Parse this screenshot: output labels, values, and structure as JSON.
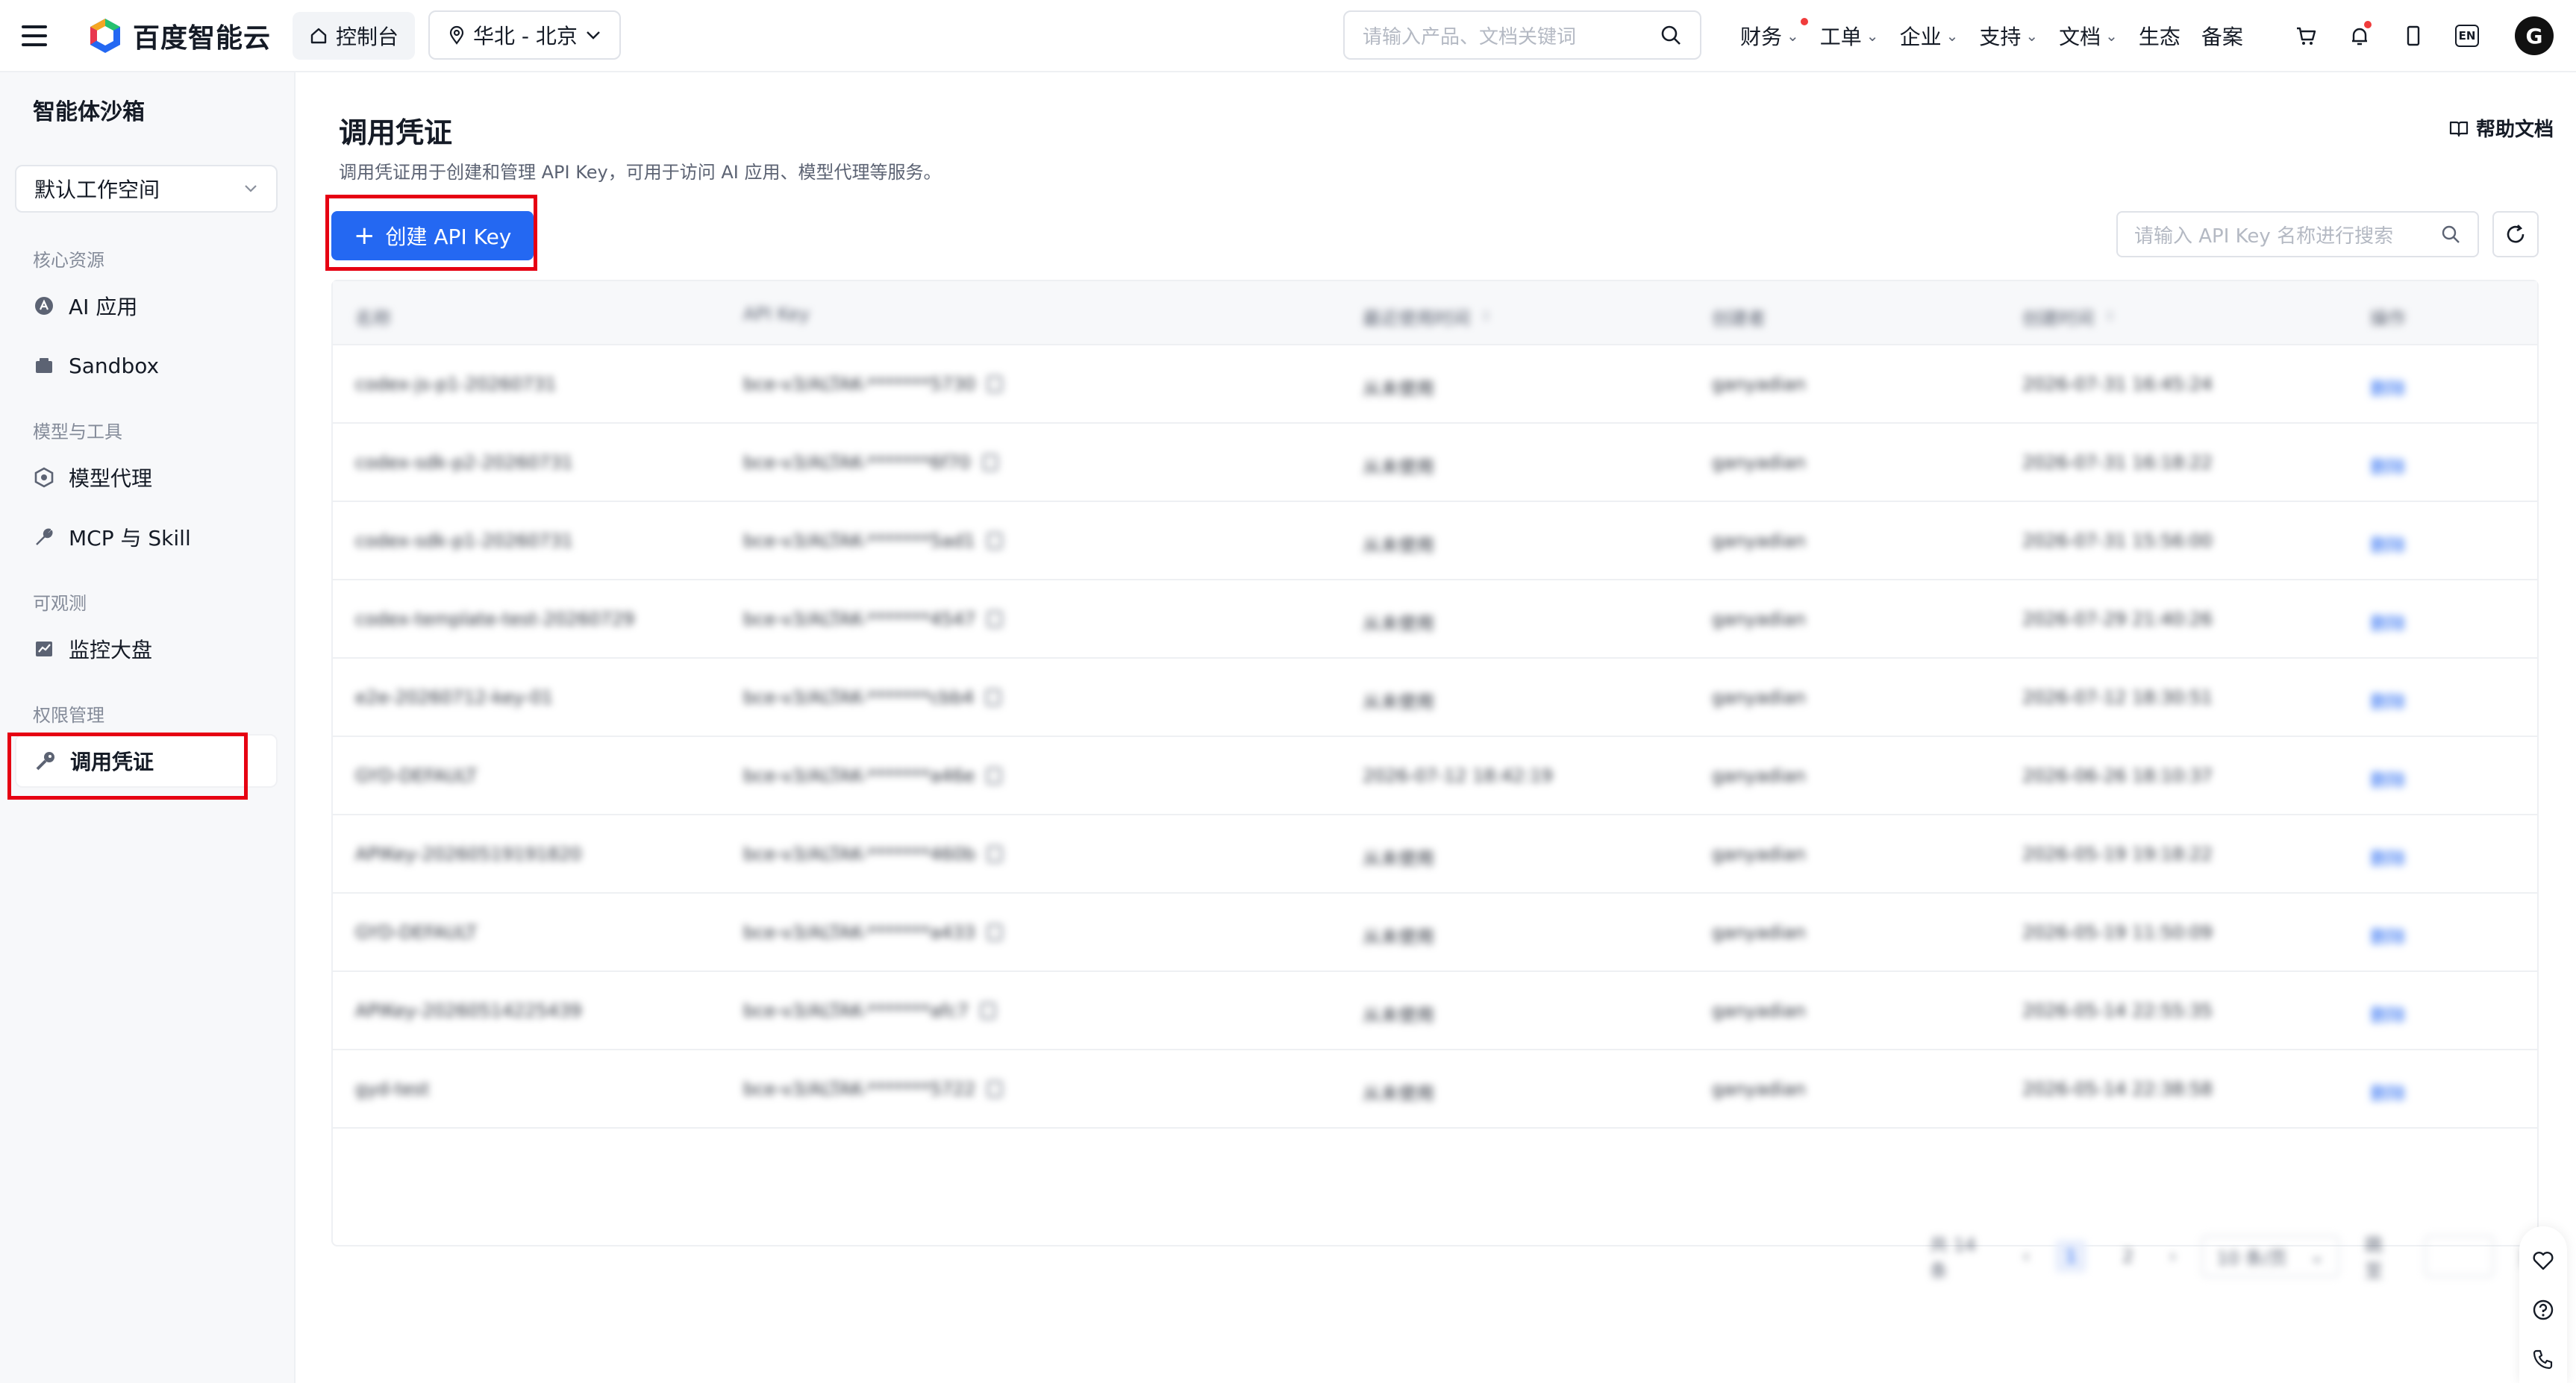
{
  "topbar": {
    "brand": "百度智能云",
    "console": "控制台",
    "region": "华北 - 北京",
    "search_placeholder": "请输入产品、文档关键词",
    "menu": [
      {
        "label": "财务",
        "has_dot": true
      },
      {
        "label": "工单",
        "has_dot": false
      },
      {
        "label": "企业",
        "has_dot": false
      },
      {
        "label": "支持",
        "has_dot": false
      },
      {
        "label": "文档",
        "has_dot": false
      },
      {
        "label": "生态",
        "has_dot": false
      },
      {
        "label": "备案",
        "has_dot": false
      }
    ],
    "lang": "EN",
    "avatar": "G"
  },
  "sidebar": {
    "title": "智能体沙箱",
    "workspace": "默认工作空间",
    "groups": [
      {
        "label": "核心资源",
        "items": [
          "AI 应用",
          "Sandbox"
        ]
      },
      {
        "label": "模型与工具",
        "items": [
          "模型代理",
          "MCP 与 Skill"
        ]
      },
      {
        "label": "可观测",
        "items": [
          "监控大盘"
        ]
      },
      {
        "label": "权限管理",
        "items": [
          "调用凭证"
        ]
      }
    ],
    "active_item": "调用凭证"
  },
  "main": {
    "title": "调用凭证",
    "description": "调用凭证用于创建和管理 API Key，可用于访问 AI 应用、模型代理等服务。",
    "help": "帮助文档",
    "create_button": "创建 API Key",
    "search_placeholder": "请输入 API Key 名称进行搜索"
  },
  "table": {
    "columns": [
      "名称",
      "API Key",
      "最近使用时间",
      "创建者",
      "创建时间",
      "操作"
    ],
    "rows": [
      {
        "name": "codex-js-p1-20260731",
        "key": "bce-v3/ALTAK-*******5730",
        "last_used": "从未使用",
        "creator": "ganyadian",
        "created": "2026-07-31 16:45:24",
        "op": "删除"
      },
      {
        "name": "codex-sdk-p2-20260731",
        "key": "bce-v3/ALTAK-*******6f70",
        "last_used": "从未使用",
        "creator": "ganyadian",
        "created": "2026-07-31 16:18:22",
        "op": "删除"
      },
      {
        "name": "codex-sdk-p1-20260731",
        "key": "bce-v3/ALTAK-*******5ad1",
        "last_used": "从未使用",
        "creator": "ganyadian",
        "created": "2026-07-31 15:56:00",
        "op": "删除"
      },
      {
        "name": "codex-template-test-20260729",
        "key": "bce-v3/ALTAK-*******4547",
        "last_used": "从未使用",
        "creator": "ganyadian",
        "created": "2026-07-29 21:40:26",
        "op": "删除"
      },
      {
        "name": "e2e-20260712-key-01",
        "key": "bce-v3/ALTAK-*******cbb4",
        "last_used": "从未使用",
        "creator": "ganyadian",
        "created": "2026-07-12 18:30:51",
        "op": "删除"
      },
      {
        "name": "GYD-DEFAULT",
        "key": "bce-v3/ALTAK-*******a46e",
        "last_used": "2026-07-12 18:42:19",
        "creator": "ganyadian",
        "created": "2026-06-26 18:10:37",
        "op": "删除"
      },
      {
        "name": "APIKey-20260519191820",
        "key": "bce-v3/ALTAK-*******460b",
        "last_used": "从未使用",
        "creator": "ganyadian",
        "created": "2026-05-19 19:18:22",
        "op": "删除"
      },
      {
        "name": "GYD-DEFAULT",
        "key": "bce-v3/ALTAK-*******a433",
        "last_used": "从未使用",
        "creator": "ganyadian",
        "created": "2026-05-19 11:50:09",
        "op": "删除"
      },
      {
        "name": "APIKey-20260514225439",
        "key": "bce-v3/ALTAK-*******afc7",
        "last_used": "从未使用",
        "creator": "ganyadian",
        "created": "2026-05-14 22:55:35",
        "op": "删除"
      },
      {
        "name": "gyd-test",
        "key": "bce-v3/ALTAK-*******5722",
        "last_used": "从未使用",
        "creator": "ganyadian",
        "created": "2026-05-14 22:38:58",
        "op": "删除"
      }
    ]
  },
  "pagination": {
    "total": "共 14 条",
    "pages": [
      "1",
      "2"
    ],
    "current": "1",
    "page_size": "10 条/页",
    "jump_label": "跳至",
    "jump_suffix": "页"
  },
  "colors": {
    "primary": "#2468f2",
    "highlight": "#e60012"
  }
}
